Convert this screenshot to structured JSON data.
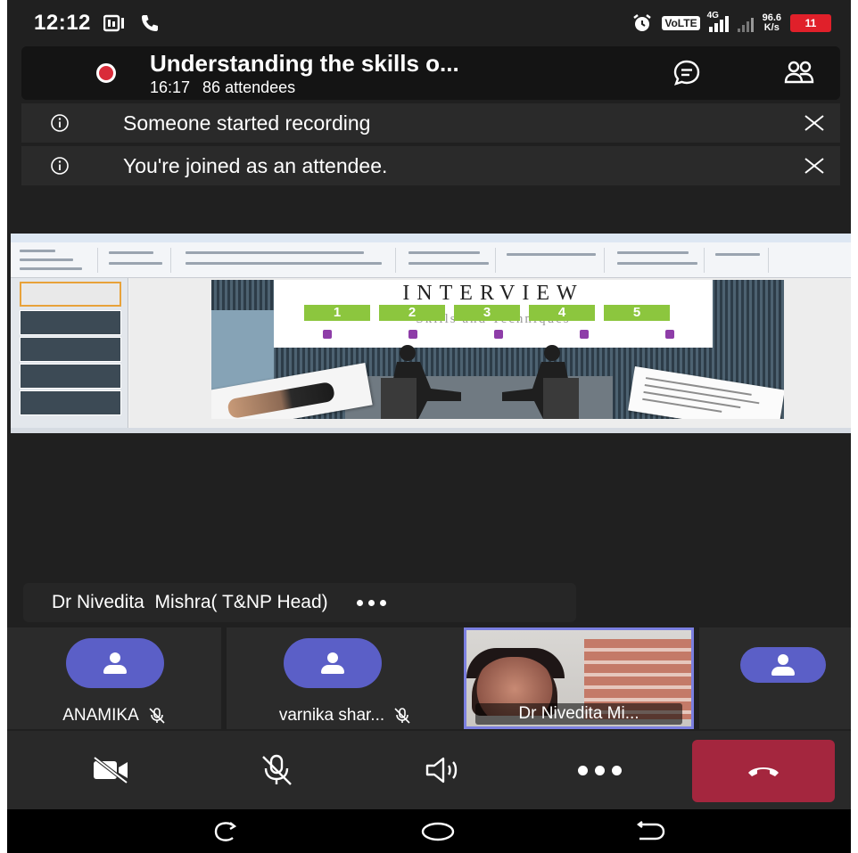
{
  "status_bar": {
    "time": "12:12",
    "volte": "VoLTE",
    "network_gen": "4G",
    "speed_value": "96.6",
    "speed_unit": "K/s",
    "battery": "11"
  },
  "meeting": {
    "title": "Understanding the skills o...",
    "duration": "16:17",
    "attendees": "86 attendees"
  },
  "banners": [
    {
      "text": "Someone started recording"
    },
    {
      "text": "You're joined as an attendee."
    }
  ],
  "shared_slide": {
    "heading": "INTERVIEW",
    "numbers": [
      "1",
      "2",
      "3",
      "4",
      "5"
    ],
    "subtitle": "Skills and Techniques"
  },
  "active_speaker": {
    "name": "Dr Nivedita  Mishra( T&NP Head)"
  },
  "participants": [
    {
      "name": "ANAMIKA",
      "muted": true
    },
    {
      "name": "varnika shar...",
      "muted": true
    },
    {
      "name": "Dr Nivedita  Mi...",
      "video": true
    }
  ],
  "colors": {
    "background": "#202020",
    "accent": "#5b5fc7",
    "recording": "#d92c3a",
    "hangup": "#a4263e",
    "slide_green": "#8cc63e"
  },
  "icons": {
    "camera": "video-off-icon",
    "mic": "mic-off-icon",
    "speaker": "speaker-icon",
    "more": "more-icon",
    "hangup": "phone-hangup-icon",
    "chat": "chat-icon",
    "people": "people-icon",
    "info": "info-icon",
    "close": "close-icon"
  }
}
